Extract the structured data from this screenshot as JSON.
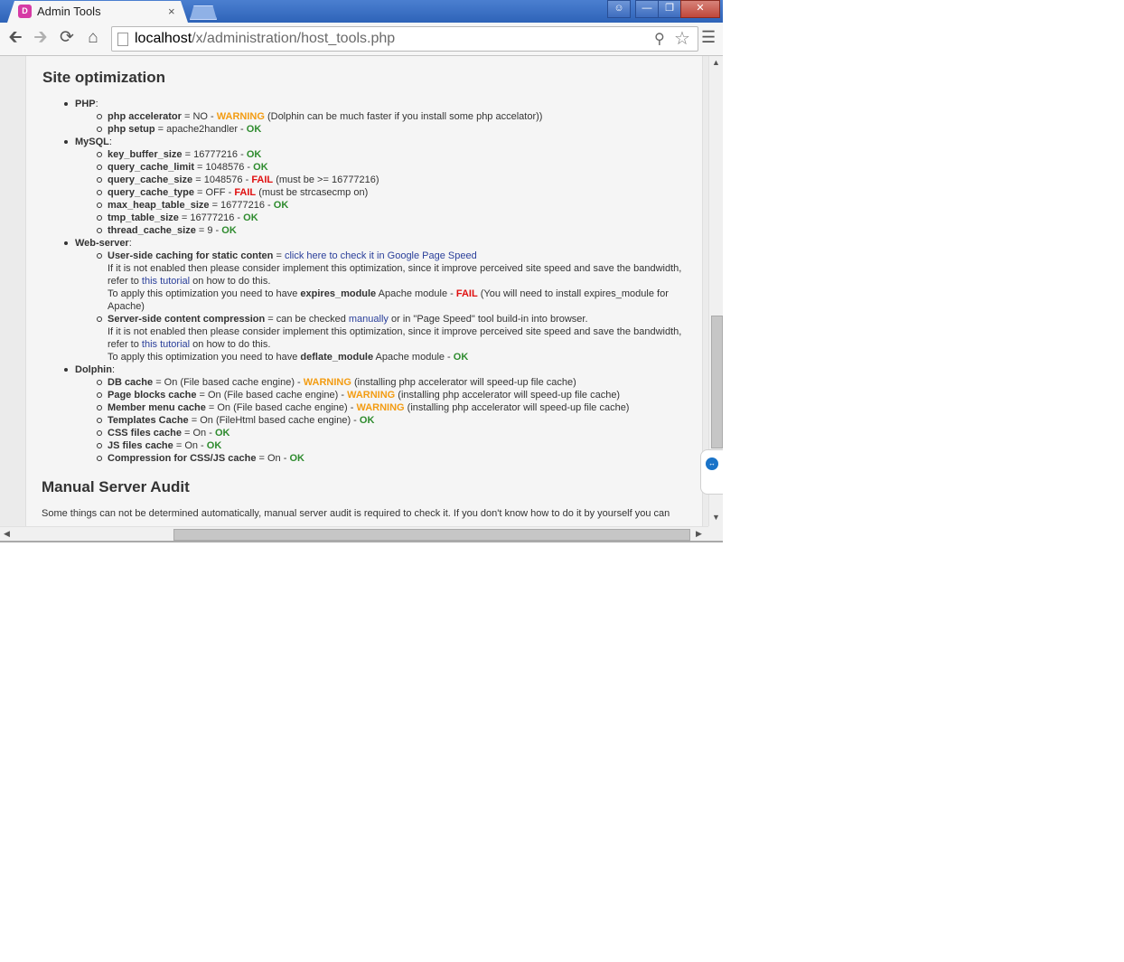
{
  "browser": {
    "tab_title": "Admin Tools",
    "tab_close": "×",
    "favicon_letter": "D",
    "url_host": "localhost",
    "url_path": "/x/administration/host_tools.php"
  },
  "page": {
    "site_heading": "Site optimization",
    "manual_heading": "Manual Server Audit",
    "manual_text": "Some things can not be determined automatically, manual server audit is required to check it. If you don't know how to do it by yourself you can"
  },
  "groups": {
    "php": "PHP",
    "mysql": "MySQL",
    "web": "Web-server",
    "dolphin": "Dolphin"
  },
  "php": {
    "accel_name": "php accelerator",
    "accel_value": " = NO - ",
    "accel_status": "WARNING",
    "accel_note": " (Dolphin can be much faster if you install some php accelator))",
    "setup_name": "php setup",
    "setup_value": " = apache2handler - ",
    "setup_status": "OK"
  },
  "mysql": {
    "r0_name": "key_buffer_size",
    "r0_value": " = 16777216 - ",
    "r0_status": "OK",
    "r1_name": "query_cache_limit",
    "r1_value": " = 1048576 - ",
    "r1_status": "OK",
    "r2_name": "query_cache_size",
    "r2_value": " = 1048576 - ",
    "r2_status": "FAIL",
    "r2_note": " (must be >= 16777216)",
    "r3_name": "query_cache_type",
    "r3_value": " = OFF - ",
    "r3_status": "FAIL",
    "r3_note": " (must be strcasecmp on)",
    "r4_name": "max_heap_table_size",
    "r4_value": " = 16777216 - ",
    "r4_status": "OK",
    "r5_name": "tmp_table_size",
    "r5_value": " = 16777216 - ",
    "r5_status": "OK",
    "r6_name": "thread_cache_size",
    "r6_value": " = 9 - ",
    "r6_status": "OK"
  },
  "web": {
    "caching_name": "User-side caching for static conten",
    "caching_eq": " = ",
    "caching_link": "click here to check it in Google Page Speed",
    "caching_desc1": "If it is not enabled then please consider implement this optimization, since it improve perceived site speed and save the bandwidth,",
    "caching_desc2a": "refer to ",
    "caching_desc2_link": "this tutorial",
    "caching_desc2b": " on how to do this.",
    "caching_desc3a": "To apply this optimization you need to have ",
    "caching_module": "expires_module",
    "caching_desc3b": " Apache module - ",
    "caching_status": "FAIL",
    "caching_desc3c": " (You will need to install expires_module for",
    "caching_desc4": "Apache)",
    "compress_name": "Server-side content compression",
    "compress_eq": " = can be checked ",
    "compress_link": "manually",
    "compress_rest": " or in \"Page Speed\" tool build-in into browser.",
    "compress_desc1": "If it is not enabled then please consider implement this optimization, since it improve perceived site speed and save the bandwidth,",
    "compress_desc2a": "refer to ",
    "compress_desc2_link": "this tutorial",
    "compress_desc2b": " on how to do this.",
    "compress_desc3a": "To apply this optimization you need to have ",
    "compress_module": "deflate_module",
    "compress_desc3b": " Apache module - ",
    "compress_status": "OK"
  },
  "dolphin": {
    "r0_name": "DB cache",
    "r0_value": " = On (File based cache engine) - ",
    "r0_status": "WARNING",
    "r0_note": " (installing php accelerator will speed-up file cache)",
    "r1_name": "Page blocks cache",
    "r1_value": " = On (File based cache engine) - ",
    "r1_status": "WARNING",
    "r1_note": " (installing php accelerator will speed-up file cache)",
    "r2_name": "Member menu cache",
    "r2_value": " = On (File based cache engine) - ",
    "r2_status": "WARNING",
    "r2_note": " (installing php accelerator will speed-up file cache)",
    "r3_name": "Templates Cache",
    "r3_value": " = On (FileHtml based cache engine) - ",
    "r3_status": "OK",
    "r4_name": "CSS files cache",
    "r4_value": " = On - ",
    "r4_status": "OK",
    "r5_name": "JS files cache",
    "r5_value": " = On - ",
    "r5_status": "OK",
    "r6_name": "Compression for CSS/JS cache",
    "r6_value": " = On - ",
    "r6_status": "OK"
  },
  "colors": {
    "ok": "#2e8b2e",
    "warning": "#f39c12",
    "fail": "#e01010",
    "link": "#2a3f9a"
  }
}
